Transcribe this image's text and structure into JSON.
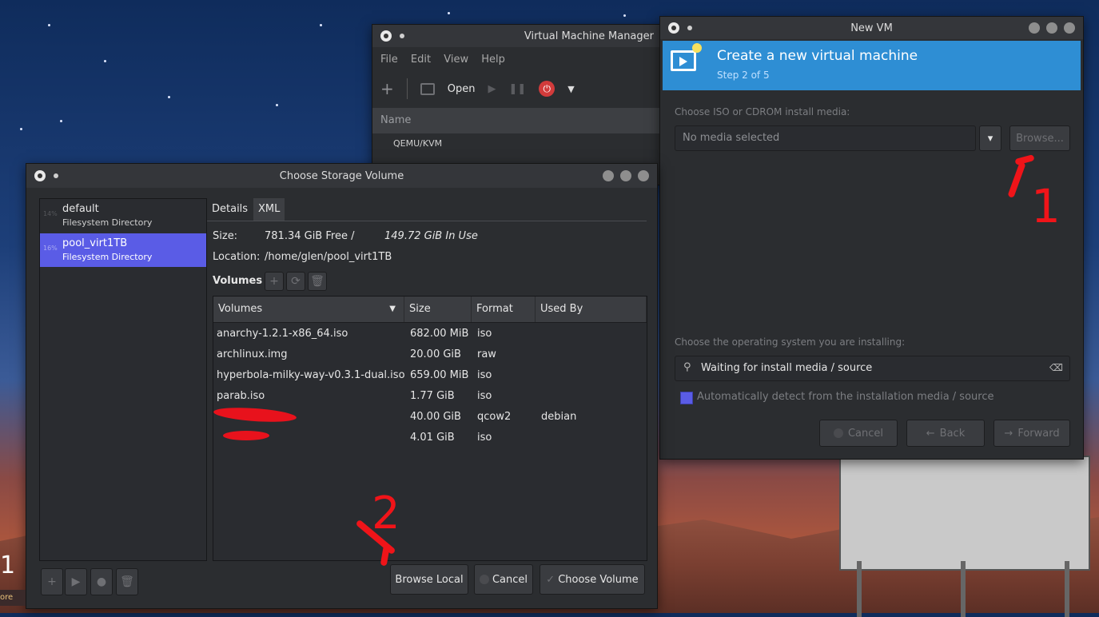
{
  "vmm": {
    "title": "Virtual Machine Manager",
    "menu": [
      "File",
      "Edit",
      "View",
      "Help"
    ],
    "open_label": "Open",
    "list_header": "Name",
    "connection": "QEMU/KVM"
  },
  "newvm": {
    "title": "New VM",
    "header_title": "Create a new virtual machine",
    "step": "Step 2 of 5",
    "iso_label": "Choose ISO or CDROM install media:",
    "media_value": "No media selected",
    "browse_label": "Browse...",
    "os_label": "Choose the operating system you are installing:",
    "os_search_value": "Waiting for install media / source",
    "auto_detect_label": "Automatically detect from the installation media / source",
    "cancel_label": "Cancel",
    "back_label": "Back",
    "forward_label": "Forward"
  },
  "storage": {
    "title": "Choose Storage Volume",
    "pools": [
      {
        "usage": "14%",
        "name": "default",
        "type": "Filesystem Directory"
      },
      {
        "usage": "16%",
        "name": "pool_virt1TB",
        "type": "Filesystem Directory"
      }
    ],
    "tabs": [
      "Details",
      "XML"
    ],
    "size_label": "Size:",
    "size_free": "781.34 GiB Free /",
    "size_used": "149.72 GiB In Use",
    "location_label": "Location:",
    "location_value": "/home/glen/pool_virt1TB",
    "volumes_label": "Volumes",
    "columns": [
      "Volumes",
      "Size",
      "Format",
      "Used By"
    ],
    "rows": [
      {
        "name": "anarchy-1.2.1-x86_64.iso",
        "size": "682.00 MiB",
        "format": "iso",
        "used_by": ""
      },
      {
        "name": "archlinux.img",
        "size": "20.00 GiB",
        "format": "raw",
        "used_by": ""
      },
      {
        "name": "hyperbola-milky-way-v0.3.1-dual.iso",
        "size": "659.00 MiB",
        "format": "iso",
        "used_by": ""
      },
      {
        "name": "parab.iso",
        "size": "1.77 GiB",
        "format": "iso",
        "used_by": ""
      },
      {
        "name": "",
        "size": "40.00 GiB",
        "format": "qcow2",
        "used_by": "debian"
      },
      {
        "name": "",
        "size": "4.01 GiB",
        "format": "iso",
        "used_by": ""
      }
    ],
    "browse_local_label": "Browse Local",
    "cancel_label": "Cancel",
    "choose_label": "Choose Volume"
  },
  "annotations": {
    "one": "1",
    "two": "2"
  },
  "colors": {
    "accent_blue": "#2e8ed4",
    "selection": "#5a5ce6",
    "annotation_red": "#f01419"
  }
}
